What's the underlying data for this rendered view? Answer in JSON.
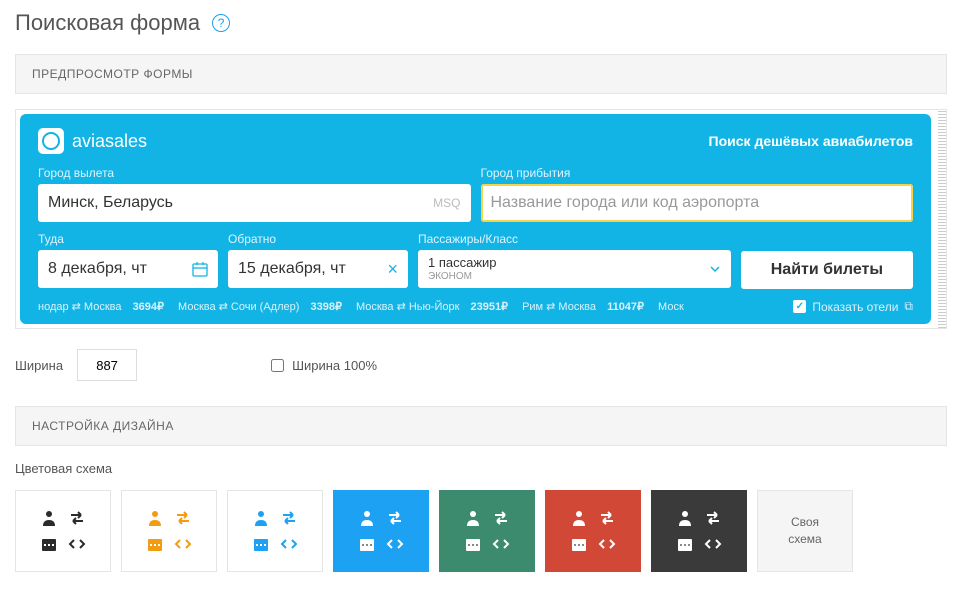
{
  "page": {
    "title": "Поисковая форма"
  },
  "sections": {
    "preview": "ПРЕДПРОСМОТР ФОРМЫ",
    "design": "НАСТРОЙКА ДИЗАЙНА"
  },
  "widget": {
    "brand": "aviasales",
    "tagline": "Поиск дешёвых авиабилетов",
    "labels": {
      "from": "Город вылета",
      "to": "Город прибытия",
      "depart": "Туда",
      "return": "Обратно",
      "pax": "Пассажиры/Класс"
    },
    "values": {
      "from": "Минск, Беларусь",
      "from_iata": "MSQ",
      "to_placeholder": "Название города или код аэропорта",
      "depart": "8 декабря, чт",
      "return": "15 декабря, чт",
      "pax_count": "1 пассажир",
      "pax_class": "ЭКОНОМ"
    },
    "search_button": "Найти билеты",
    "ticker": [
      {
        "route": "нодар ⇄ Москва",
        "price": "3694₽"
      },
      {
        "route": "Москва ⇄ Сочи (Адлер)",
        "price": "3398₽"
      },
      {
        "route": "Москва ⇄ Нью-Йорк",
        "price": "23951₽"
      },
      {
        "route": "Рим ⇄ Москва",
        "price": "11047₽"
      },
      {
        "route": "Моск",
        "price": ""
      }
    ],
    "show_hotels": "Показать отели"
  },
  "width": {
    "label": "Ширина",
    "value": "887",
    "full_label": "Ширина 100%"
  },
  "color_scheme": {
    "label": "Цветовая схема",
    "custom": "Своя схема",
    "options": [
      {
        "bg": "#ffffff",
        "accent": "#2b2b2b",
        "selected": false
      },
      {
        "bg": "#ffffff",
        "accent": "#f39c12",
        "selected": false
      },
      {
        "bg": "#ffffff",
        "accent": "#1da1f2",
        "selected": false
      },
      {
        "bg": "#1da1f2",
        "accent": "#ffffff",
        "selected": true
      },
      {
        "bg": "#3d8b6f",
        "accent": "#ffffff",
        "selected": false
      },
      {
        "bg": "#d14836",
        "accent": "#ffffff",
        "selected": false
      },
      {
        "bg": "#3a3a3a",
        "accent": "#ffffff",
        "selected": false
      }
    ]
  }
}
